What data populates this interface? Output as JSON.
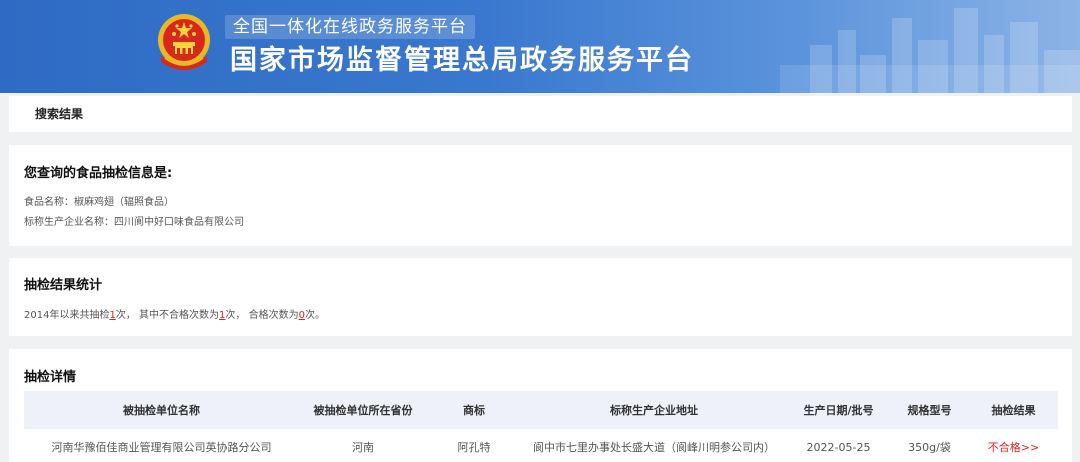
{
  "header": {
    "subtitle": "全国一体化在线政务服务平台",
    "title": "国家市场监督管理总局政务服务平台"
  },
  "breadcrumb": {
    "label": "搜索结果"
  },
  "query_info": {
    "title": "您查询的食品抽检信息是:",
    "food_name": "食品名称：椒麻鸡翅（辐照食品）",
    "producer": "标称生产企业名称：四川阆中好口味食品有限公司"
  },
  "stats": {
    "title": "抽检结果统计",
    "text_a": "2014年以来共抽检",
    "total": "1",
    "text_b": "次，  其中不合格次数为",
    "failed": "1",
    "text_c": "次，  合格次数为",
    "passed": "0",
    "text_d": "次。"
  },
  "details": {
    "title": "抽检详情",
    "columns": [
      "被抽检单位名称",
      "被抽检单位所在省份",
      "商标",
      "标称生产企业地址",
      "生产日期/批号",
      "规格型号",
      "抽检结果"
    ],
    "rows": [
      {
        "unit": "河南华豫佰佳商业管理有限公司英协路分公司",
        "province": "河南",
        "brand": "阿孔特",
        "address": "阆中市七里办事处长盛大道（阆峰川明参公司内）",
        "date": "2022-05-25",
        "spec": "350g/袋",
        "result": "不合格>>"
      }
    ]
  },
  "colors": {
    "banner": "#3a78cf",
    "fail": "#e02020",
    "table_header": "#eef1f7"
  }
}
